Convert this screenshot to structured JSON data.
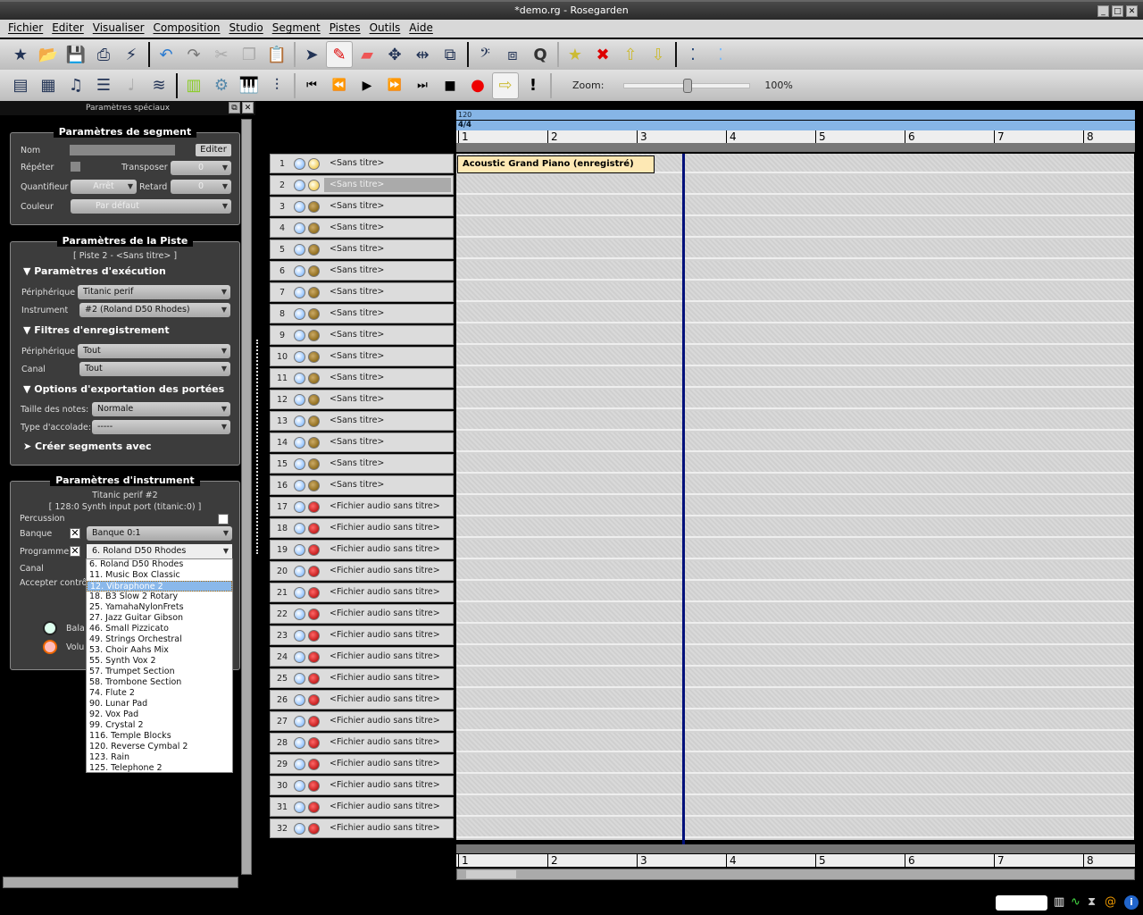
{
  "window": {
    "title": "*demo.rg - Rosegarden"
  },
  "menu": [
    "Fichier",
    "Editer",
    "Visualiser",
    "Composition",
    "Studio",
    "Segment",
    "Pistes",
    "Outils",
    "Aide"
  ],
  "toolbar": {
    "zoom_label": "Zoom:",
    "zoom_value": "100%",
    "zoom_fraction": 0.5
  },
  "sidebar": {
    "title": "Paramètres spéciaux",
    "segment": {
      "title": "Paramètres de segment",
      "name_label": "Nom",
      "edit_button": "Editer",
      "repeat_label": "Répéter",
      "transpose_label": "Transposer",
      "transpose_value": "0",
      "quantize_label": "Quantifieur",
      "quantize_value": "Arrêt",
      "delay_label": "Retard",
      "delay_value": "0",
      "color_label": "Couleur",
      "color_value": "Par défaut"
    },
    "track": {
      "title": "Paramètres de la Piste",
      "subtitle": "[ Piste 2 - <Sans titre> ]",
      "exec_section": "▼ Paramètres d'exécution",
      "device_label": "Périphérique",
      "device_value": "Titanic perif",
      "instrument_label": "Instrument",
      "instrument_value": "#2 (Roland D50 Rhodes)",
      "rec_section": "▼ Filtres d'enregistrement",
      "rec_device_label": "Périphérique",
      "rec_device_value": "Tout",
      "channel_label": "Canal",
      "channel_value": "Tout",
      "export_section": "▼ Options d'exportation des portées",
      "notesize_label": "Taille des notes:",
      "notesize_value": "Normale",
      "bracket_label": "Type d'accolade:",
      "bracket_value": "-----",
      "create_section": "➤ Créer segments avec"
    },
    "instrument": {
      "title": "Paramètres d'instrument",
      "device": "Titanic perif  #2",
      "port": "[ 128:0 Synth input port (titanic:0) ]",
      "percussion_label": "Percussion",
      "bank_label": "Banque",
      "bank_value": "Banque 0:1",
      "program_label": "Programme",
      "program_value": "6. Roland D50 Rhodes",
      "channel_label": "Canal",
      "accept_label": "Accepter contrô",
      "balance_label": "Bala",
      "volume_label": "Volu",
      "program_options": [
        "6. Roland D50 Rhodes",
        "11. Music Box Classic",
        "12. Vibraphone 2",
        "18. B3 Slow 2 Rotary",
        "25. YamahaNylonFrets",
        "27. Jazz Guitar Gibson",
        "46. Small Pizzicato",
        "49. Strings Orchestral",
        "53. Choir Aahs Mix",
        "55. Synth Vox 2",
        "57. Trumpet Section",
        "58. Trombone Section",
        "74. Flute 2",
        "90. Lunar Pad",
        "92. Vox Pad",
        "99. Crystal 2",
        "116. Temple Blocks",
        "120. Reverse Cymbal 2",
        "123. Rain",
        "125. Telephone 2"
      ],
      "selected_option": "12. Vibraphone 2"
    }
  },
  "ruler": {
    "tempo": "120",
    "timesig": "4/4",
    "bars": [
      "1",
      "2",
      "3",
      "4",
      "5",
      "6",
      "7",
      "8"
    ]
  },
  "tracks": {
    "count_midi": 16,
    "midi_label": "<Sans titre>",
    "audio_label": "<Fichier audio sans titre>",
    "selected": 2,
    "total": 32
  },
  "segment": {
    "label": "Acoustic Grand Piano (enregistré)"
  }
}
